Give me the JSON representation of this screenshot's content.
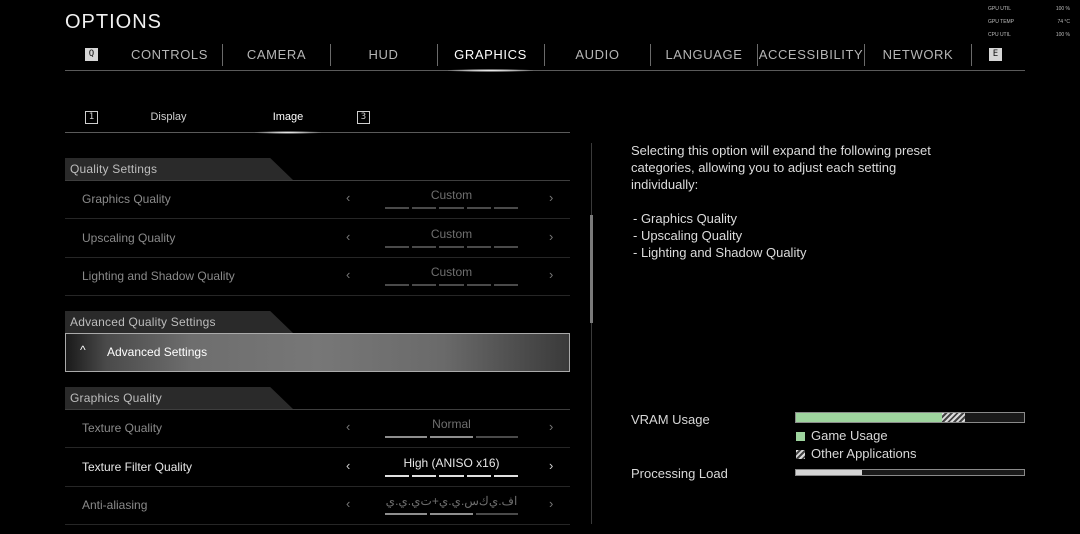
{
  "header": {
    "title": "OPTIONS"
  },
  "hw_stats": [
    {
      "label": "GPU UTIL",
      "value": "100 %"
    },
    {
      "label": "GPU TEMP",
      "value": "74 °C"
    },
    {
      "label": "CPU UTIL",
      "value": "100 %"
    }
  ],
  "tabs": {
    "key_left": "Q",
    "key_right": "E",
    "items": [
      {
        "label": "CONTROLS",
        "active": false
      },
      {
        "label": "CAMERA",
        "active": false
      },
      {
        "label": "HUD",
        "active": false
      },
      {
        "label": "GRAPHICS",
        "active": true
      },
      {
        "label": "AUDIO",
        "active": false
      },
      {
        "label": "LANGUAGE",
        "active": false
      },
      {
        "label": "ACCESSIBILITY",
        "active": false
      },
      {
        "label": "NETWORK",
        "active": false
      }
    ]
  },
  "subtabs": {
    "key_left": "1",
    "key_right": "3",
    "items": [
      {
        "label": "Display",
        "active": false
      },
      {
        "label": "Image",
        "active": true
      }
    ]
  },
  "sections": {
    "quality_settings": "Quality Settings",
    "advanced_quality_settings": "Advanced Quality Settings",
    "graphics_quality": "Graphics Quality"
  },
  "rows": {
    "graphics_quality": {
      "label": "Graphics Quality",
      "value": "Custom",
      "level": 0
    },
    "upscaling_quality": {
      "label": "Upscaling Quality",
      "value": "Custom",
      "level": 0
    },
    "lighting_shadow_quality": {
      "label": "Lighting and Shadow Quality",
      "value": "Custom",
      "level": 0
    },
    "texture_quality": {
      "label": "Texture Quality",
      "value": "Normal",
      "level": 2,
      "segments": 3
    },
    "texture_filter_quality": {
      "label": "Texture Filter Quality",
      "value": "High (ANISO x16)",
      "level": 5,
      "segments": 5
    },
    "anti_aliasing": {
      "label": "Anti-aliasing",
      "value": "ﺍﻑ.ﻱﻙﺱ.ﻱ.ﻱ+ﺕﻱ.ﻱ.ﻱ",
      "level": 2,
      "segments": 3
    }
  },
  "advanced_settings": {
    "label": "Advanced Settings",
    "arrow": "^"
  },
  "arrows": {
    "left": "‹",
    "right": "›"
  },
  "description": {
    "text": "Selecting this option will expand the following preset categories, allowing you to adjust each setting individually:",
    "items": [
      "- Graphics Quality",
      "- Upscaling Quality",
      "- Lighting and Shadow Quality"
    ]
  },
  "meters": {
    "vram": {
      "label": "VRAM Usage",
      "game_fraction": 0.64,
      "other_fraction": 0.1,
      "legend_game": "Game Usage",
      "legend_other": "Other Applications"
    },
    "processing": {
      "label": "Processing Load",
      "fraction": 0.29
    }
  },
  "colors": {
    "game_usage": "#9ed49e",
    "processing": "#d4d4d4"
  }
}
